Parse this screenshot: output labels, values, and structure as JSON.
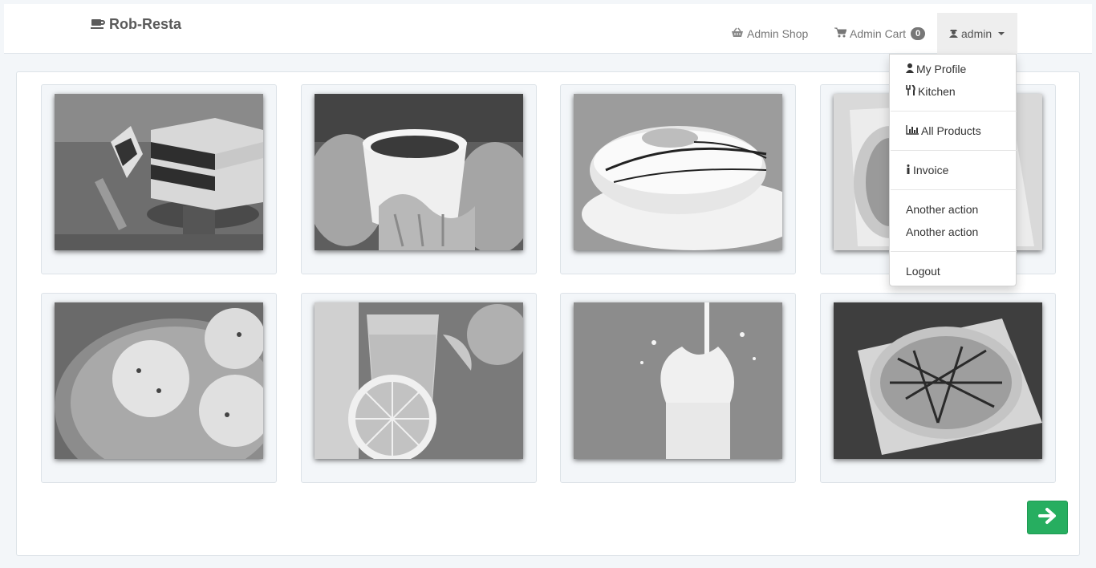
{
  "brand": {
    "name": "Rob-Resta",
    "icon": "coffee-cup-icon"
  },
  "nav": {
    "shop_label": "Admin Shop",
    "shop_icon": "basket-icon",
    "cart_label": "Admin Cart",
    "cart_icon": "cart-icon",
    "cart_count": "0",
    "user_label": "admin",
    "user_icon": "user-secret-icon"
  },
  "dropdown": {
    "items": [
      {
        "label": "My Profile",
        "icon": "user-icon"
      },
      {
        "label": "Kitchen",
        "icon": "cutlery-icon"
      },
      {
        "label": "All Products",
        "icon": "bar-chart-icon"
      },
      {
        "label": "Invoice",
        "icon": "info-icon"
      },
      {
        "label": "Another action"
      },
      {
        "label": "Another action"
      },
      {
        "label": "Logout"
      }
    ]
  },
  "products": [
    {
      "subject": "chocolate-layer-cake"
    },
    {
      "subject": "tea-cup-knit-mittens"
    },
    {
      "subject": "glazed-donut"
    },
    {
      "subject": "wrapped-sandwich"
    },
    {
      "subject": "ice-cream-scoops"
    },
    {
      "subject": "orange-juice"
    },
    {
      "subject": "milk-splash"
    },
    {
      "subject": "pizza"
    }
  ],
  "pagination": {
    "next_icon": "arrow-right-icon"
  },
  "colors": {
    "accent": "#27ae60",
    "navbar_bg": "#ffffff",
    "page_bg": "#f3f6f9",
    "badge_bg": "#777777"
  }
}
